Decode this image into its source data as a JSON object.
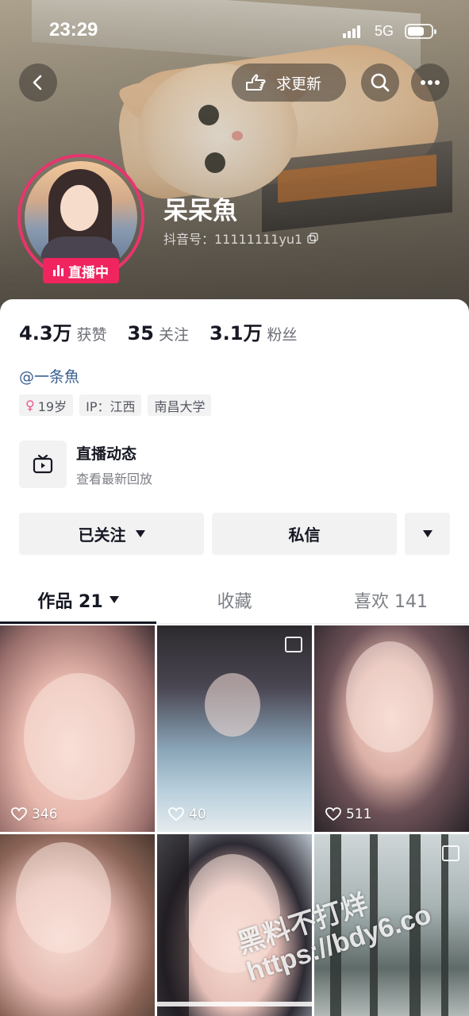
{
  "status_bar": {
    "time": "23:29",
    "network": "5G"
  },
  "header": {
    "update_button_label": "求更新",
    "nickname": "呆呆魚",
    "douyin_id": "抖音号：11111111yu1",
    "live_badge": "直播中"
  },
  "stats": [
    {
      "num": "4.3万",
      "label": "获赞"
    },
    {
      "num": "35",
      "label": "关注"
    },
    {
      "num": "3.1万",
      "label": "粉丝"
    }
  ],
  "mention": "@一条魚",
  "tags": {
    "age": "19岁",
    "ip": "IP：江西",
    "school": "南昌大学"
  },
  "live_dynamic": {
    "title": "直播动态",
    "subtitle": "查看最新回放"
  },
  "buttons": {
    "followed": "已关注",
    "message": "私信"
  },
  "tabs": {
    "works": "作品 21",
    "collect": "收藏",
    "likes": "喜欢 141"
  },
  "grid": [
    {
      "likes": "346"
    },
    {
      "likes": "40"
    },
    {
      "likes": "511"
    },
    {
      "likes": ""
    },
    {
      "likes": ""
    },
    {
      "likes": ""
    }
  ],
  "watermark": {
    "line1": "黑料不打烊",
    "line2": "https://bdy6.co"
  },
  "colors": {
    "live_red": "#f0245f",
    "link_blue": "#3a5f91"
  }
}
